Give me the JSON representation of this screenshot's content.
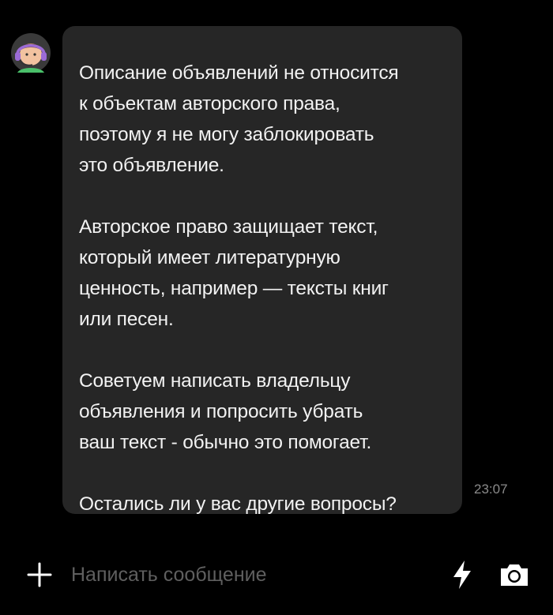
{
  "chat": {
    "agent_avatar": {
      "icon": "support-agent-headset-icon",
      "accent_color": "#9b6bd6"
    },
    "message": {
      "paragraphs": [
        {
          "lines": [
            "Описание объявлений не относится",
            "к объектам авторского права,",
            "поэтому я не могу заблокировать",
            "это объявление."
          ]
        },
        {
          "lines": [
            "Авторское право защищает текст,",
            "который имеет литературную",
            "ценность, например — тексты книг",
            "или песен."
          ]
        },
        {
          "lines": [
            "Советуем написать владельцу",
            "объявления и попросить убрать",
            "ваш текст - обычно это помогает."
          ]
        },
        {
          "lines": [
            "Остались ли у вас другие вопросы?"
          ]
        }
      ],
      "time": "23:07",
      "bubble_color": "#262626"
    }
  },
  "composer": {
    "placeholder": "Написать сообщение",
    "value": "",
    "icons": {
      "attach": "plus-icon",
      "quick": "lightning-icon",
      "camera": "camera-icon"
    }
  }
}
